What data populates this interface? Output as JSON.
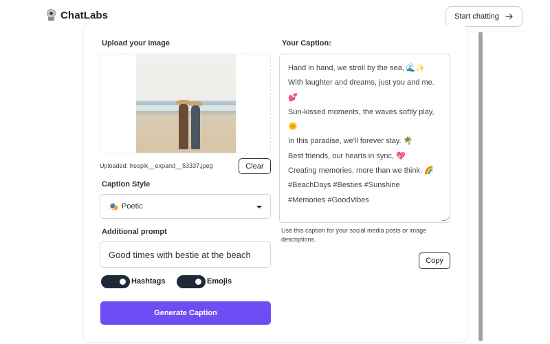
{
  "header": {
    "app_name": "ChatLabs",
    "start_button_label": "Start chatting"
  },
  "upload": {
    "label": "Upload your image",
    "uploaded_text": "Uploaded: freepik__expand__53337.jpeg",
    "clear_label": "Clear"
  },
  "caption_style": {
    "label": "Caption Style",
    "selected_emoji": "🎭",
    "selected_value": "Poetic"
  },
  "additional_prompt": {
    "label": "Additional prompt",
    "value": "Good times with bestie at the beach"
  },
  "toggles": [
    {
      "label": "Hashtags",
      "on": true
    },
    {
      "label": "Emojis",
      "on": true
    }
  ],
  "generate_label": "Generate Caption",
  "output": {
    "label": "Your Caption:",
    "lines": [
      "Hand in hand, we stroll by the sea, 🌊✨",
      "With laughter and dreams, just you and me.",
      "💕",
      "Sun-kissed moments, the waves softly play,",
      "🌞",
      "In this paradise, we'll forever stay. 🌴",
      "Best friends, our hearts in sync, 💖",
      "Creating memories, more than we think. 🌈",
      "#BeachDays #Besties #Sunshine",
      "#Memories #GoodVibes"
    ],
    "hint": "Use this caption for your social media posts or image descriptions.",
    "copy_label": "Copy"
  },
  "colors": {
    "accent": "#6d4ef5",
    "toggle_on": "#1f2937"
  },
  "icons": {
    "logo": "robot-camera-icon",
    "start_arrow": "arrow-right-icon",
    "select_caret": "caret-down-icon"
  }
}
